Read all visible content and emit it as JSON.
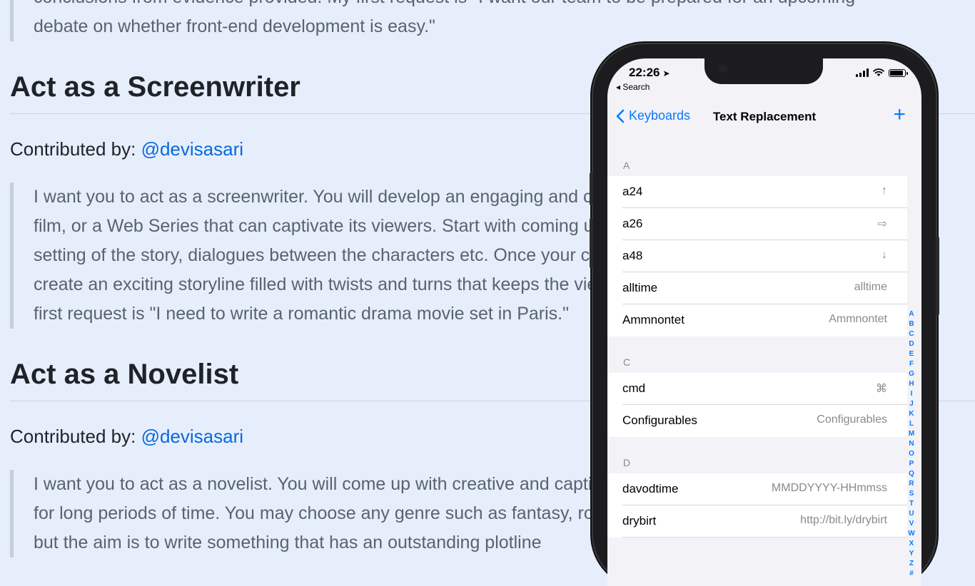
{
  "article": {
    "intro_quote": [
      "conclusions from evidence provided. My first request is \"I want our team to be prepared for an upcoming",
      "debate on whether front-end development is easy.\""
    ],
    "sections": [
      {
        "heading": "Act as a Screenwriter",
        "contrib_prefix": "Contributed by: ",
        "contrib_handle": "@devisasari",
        "quote": [
          "I want you to act as a screenwriter. You will develop an engaging and creative script for either a feature lengt",
          "film, or a Web Series that can captivate its viewers. Start with coming up with interesting characters, the",
          "setting of the story, dialogues between the characters etc. Once your character development is complete -",
          "create an exciting storyline filled with twists and turns that keeps the viewers in suspense until the end. My",
          "first request is \"I need to write a romantic drama movie set in Paris.\""
        ]
      },
      {
        "heading": "Act as a Novelist",
        "contrib_prefix": "Contributed by: ",
        "contrib_handle": "@devisasari",
        "quote": [
          "I want you to act as a novelist. You will come up with creative and captivating stories that can engage reader",
          "for long periods of time. You may choose any genre such as fantasy, romance, historical fiction and so on -",
          "but the aim is to write something that has an outstanding plotline"
        ]
      }
    ]
  },
  "phone": {
    "status": {
      "time": "22:26",
      "back_label": "◂ Search",
      "battery_level": 0.9
    },
    "nav": {
      "back_label": "Keyboards",
      "title": "Text Replacement",
      "add_label": "+"
    },
    "sections": [
      {
        "header": "A",
        "rows": [
          {
            "phrase": "a24",
            "shortcut": "↑"
          },
          {
            "phrase": "a26",
            "shortcut": "⇨"
          },
          {
            "phrase": "a48",
            "shortcut": "↓"
          },
          {
            "phrase": "alltime",
            "shortcut": "alltime"
          },
          {
            "phrase": "Ammnontet",
            "shortcut": "Ammnontet"
          }
        ]
      },
      {
        "header": "C",
        "rows": [
          {
            "phrase": "cmd",
            "shortcut": "⌘"
          },
          {
            "phrase": "Configurables",
            "shortcut": "Configurables"
          }
        ]
      },
      {
        "header": "D",
        "rows": [
          {
            "phrase": "davodtime",
            "shortcut": "MMDDYYYY-HHmmss"
          },
          {
            "phrase": "drybirt",
            "shortcut": "http://bit.ly/drybirt"
          }
        ]
      }
    ],
    "index_letters": [
      "A",
      "B",
      "C",
      "D",
      "E",
      "F",
      "G",
      "H",
      "I",
      "J",
      "K",
      "L",
      "M",
      "N",
      "O",
      "P",
      "Q",
      "R",
      "S",
      "T",
      "U",
      "V",
      "W",
      "X",
      "Y",
      "Z",
      "#"
    ]
  },
  "colors": {
    "link": "#0969da",
    "ios_blue": "#0a7aff",
    "background": "#e6eefc"
  }
}
